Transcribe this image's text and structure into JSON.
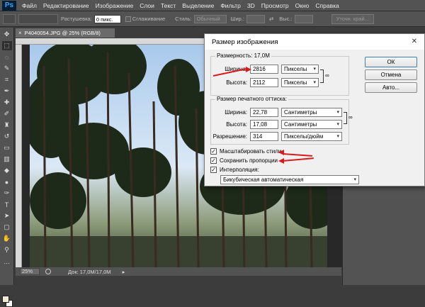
{
  "app": {
    "logo": "Ps",
    "menus": [
      "Файл",
      "Редактирование",
      "Изображение",
      "Слои",
      "Текст",
      "Выделение",
      "Фильтр",
      "3D",
      "Просмотр",
      "Окно",
      "Справка"
    ]
  },
  "options_bar": {
    "feather_label": "Растушевка:",
    "feather_value": "0 пикс.",
    "antialias_label": "Сглаживание",
    "style_label": "Стиль:",
    "style_value": "Обычный",
    "width_label": "Шир.:",
    "height_label": "Выс.:",
    "refine_label": "Уточн. край..."
  },
  "document": {
    "tab_title": "P4040054.JPG @ 25% (RGB/8)",
    "zoom": "25%",
    "doc_info": "Док: 17,0M/17,0M"
  },
  "dialog": {
    "title": "Размер изображения",
    "pixel_dims_label": "Размерность:",
    "pixel_dims_value": "17,0M",
    "width_label": "Ширина:",
    "width_value": "2816",
    "width_unit": "Пикселы",
    "height_label": "Высота:",
    "height_value": "2112",
    "height_unit": "Пикселы",
    "print_size_label": "Размер печатного оттиска:",
    "print_width_label": "Ширина:",
    "print_width_value": "22,78",
    "print_width_unit": "Сантиметры",
    "print_height_label": "Высота:",
    "print_height_value": "17,08",
    "print_height_unit": "Сантиметры",
    "resolution_label": "Разрешение:",
    "resolution_value": "314",
    "resolution_unit": "Пикселы/дюйм",
    "scale_styles_label": "Масштабировать стили",
    "constrain_label": "Сохранить пропорции",
    "resample_label": "Интерполяция:",
    "resample_value": "Бикубическая автоматическая",
    "ok_label": "ОК",
    "cancel_label": "Отмена",
    "auto_label": "Авто...",
    "scale_styles_checked": true,
    "constrain_checked": true,
    "resample_checked": true
  },
  "colors": {
    "annotation_arrow": "#d81b1b",
    "ps_blue": "#31a8ff"
  }
}
